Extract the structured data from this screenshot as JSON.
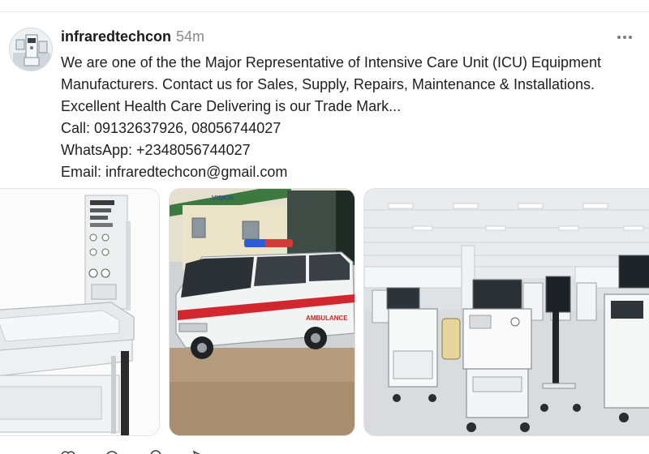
{
  "post": {
    "username": "infraredtechcon",
    "time": "54m",
    "text_lines": [
      "We are one of the the Major Representative of Intensive Care Unit (ICU) Equipment",
      "Manufacturers. Contact us for Sales, Supply, Repairs, Maintenance & Installations.",
      "Excellent Health Care Delivering is our Trade Mark...",
      "Call: 09132637926, 08056744027",
      "WhatsApp: +2348056744027",
      "Email: infraredtechcon@gmail.com"
    ],
    "media": [
      {
        "subject": "infant incubator"
      },
      {
        "subject": "ambulance van",
        "van_text": "AMBULANCE",
        "building_sign": "VISION"
      },
      {
        "subject": "anaesthesia machines showroom"
      }
    ]
  },
  "icons": {
    "more": "more-horizontal-icon",
    "actions": [
      "like-icon",
      "comment-icon",
      "repost-icon",
      "share-icon"
    ]
  },
  "colors": {
    "username": "#1a1a1a",
    "time": "#8a8a8a",
    "ambulance_stripe": "#d2272e",
    "beacon": "#2e5bd8"
  }
}
